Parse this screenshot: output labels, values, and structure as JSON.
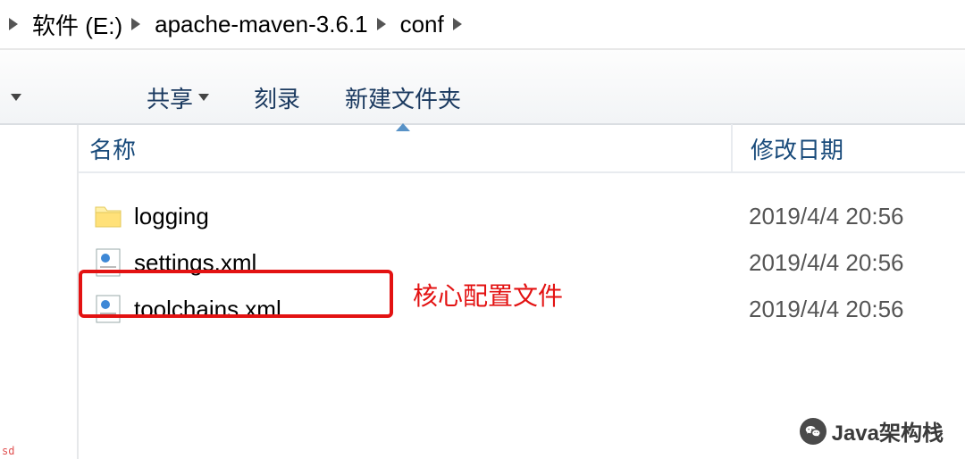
{
  "breadcrumb": {
    "parts": [
      "软件 (E:)",
      "apache-maven-3.6.1",
      "conf"
    ]
  },
  "toolbar": {
    "share": "共享",
    "burn": "刻录",
    "new_folder": "新建文件夹"
  },
  "columns": {
    "name": "名称",
    "date": "修改日期"
  },
  "files": [
    {
      "name": "logging",
      "date": "2019/4/4 20:56",
      "type": "folder"
    },
    {
      "name": "settings.xml",
      "date": "2019/4/4 20:56",
      "type": "xml"
    },
    {
      "name": "toolchains.xml",
      "date": "2019/4/4 20:56",
      "type": "xml"
    }
  ],
  "annotation": "核心配置文件",
  "watermark": "Java架构栈",
  "sd": "sd"
}
